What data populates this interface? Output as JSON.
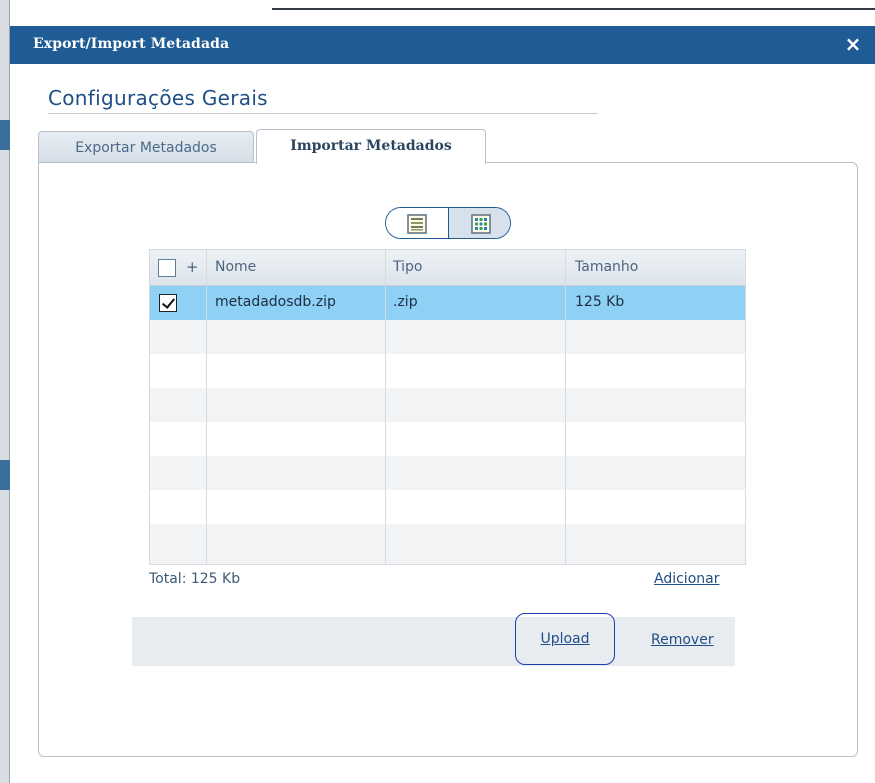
{
  "dialog": {
    "title": "Export/Import Metadada",
    "close_glyph": "×"
  },
  "section": {
    "title": "Configurações Gerais"
  },
  "tabs": [
    {
      "label": "Exportar Metadados",
      "active": false
    },
    {
      "label": "Importar Metadados",
      "active": true
    }
  ],
  "view_toggle": {
    "options": [
      "list-view-icon",
      "grid-view-icon"
    ],
    "selected": "list-view-icon"
  },
  "table": {
    "header": {
      "add_glyph": "+",
      "columns": [
        "Nome",
        "Tipo",
        "Tamanho"
      ]
    },
    "rows": [
      {
        "checked": true,
        "nome": "metadadosdb.zip",
        "tipo": ".zip",
        "tamanho": "125 Kb"
      }
    ]
  },
  "footer": {
    "total": "Total: 125 Kb",
    "add_link": "Adicionar"
  },
  "actions": {
    "upload": "Upload",
    "remove": "Remover"
  },
  "colors": {
    "titlebar": "#1f5c96",
    "selected_row": "#8fd0f5",
    "link": "#1f4f86"
  }
}
